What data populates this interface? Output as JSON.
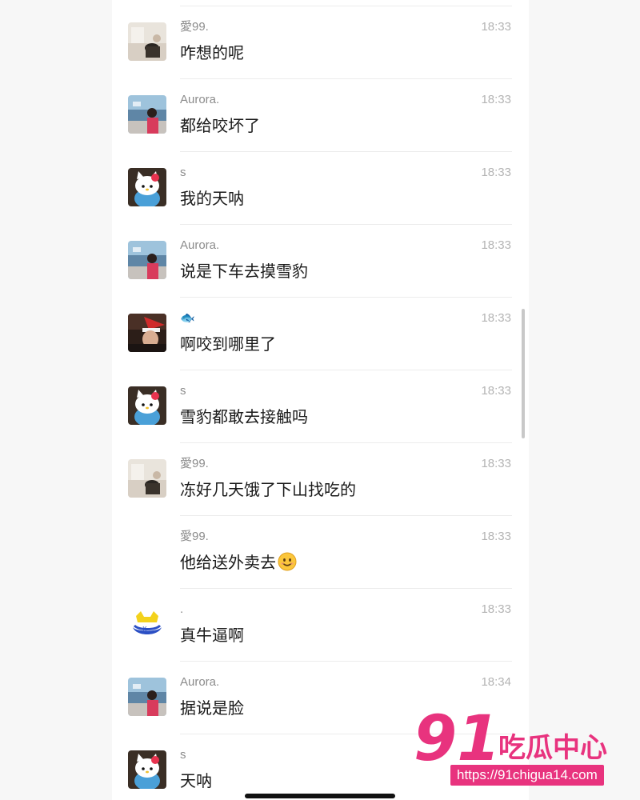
{
  "messages": [
    {
      "sender": "愛99.",
      "time": "18:33",
      "text": "咋想的呢",
      "avatar": "photo-room"
    },
    {
      "sender": "Aurora.",
      "time": "18:33",
      "text": "都给咬坏了",
      "avatar": "photo-sea-girl"
    },
    {
      "sender": "s",
      "time": "18:33",
      "text": "我的天呐",
      "avatar": "hello-kitty"
    },
    {
      "sender": "Aurora.",
      "time": "18:33",
      "text": "说是下车去摸雪豹",
      "avatar": "photo-sea-girl"
    },
    {
      "sender": "🐟",
      "time": "18:33",
      "text": "啊咬到哪里了",
      "avatar": "photo-santa-hat"
    },
    {
      "sender": "s",
      "time": "18:33",
      "text": "雪豹都敢去接触吗",
      "avatar": "hello-kitty"
    },
    {
      "sender": "愛99.",
      "time": "18:33",
      "text": "冻好几天饿了下山找吃的",
      "avatar": "photo-room"
    },
    {
      "sender": "愛99.",
      "time": "18:33",
      "text": "他给送外卖去",
      "avatar": "none",
      "emoji": "smiley-icon"
    },
    {
      "sender": ".",
      "time": "18:33",
      "text": "真牛逼啊",
      "avatar": "blue-cat-logo"
    },
    {
      "sender": "Aurora.",
      "time": "18:34",
      "text": "据说是脸",
      "avatar": "photo-sea-girl"
    },
    {
      "sender": "s",
      "time": "",
      "text": "天呐",
      "avatar": "hello-kitty"
    }
  ],
  "watermark": {
    "logo_text": "91吃瓜中心",
    "url": "https://91chigua14.com"
  },
  "colors": {
    "page_bg": "#f7f7f7",
    "panel_bg": "#ffffff",
    "divider": "#ececec",
    "watermark_pink": "#e8337e"
  }
}
